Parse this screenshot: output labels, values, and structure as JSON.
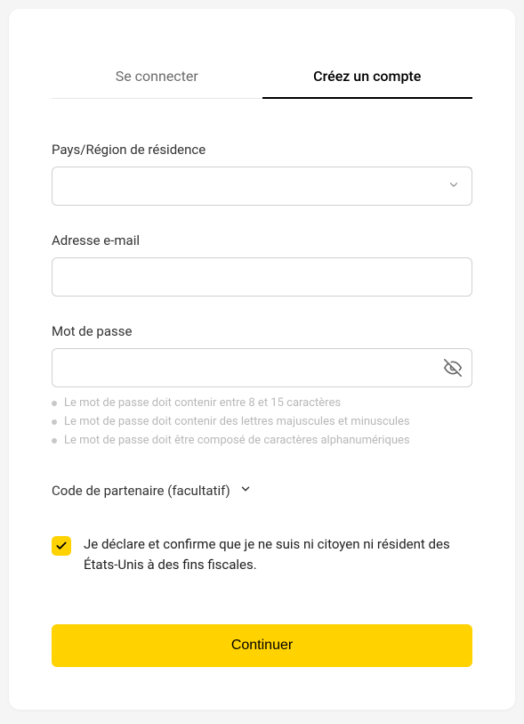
{
  "tabs": {
    "login": "Se connecter",
    "signup": "Créez un compte"
  },
  "fields": {
    "country": {
      "label": "Pays/Région de résidence"
    },
    "email": {
      "label": "Adresse e-mail"
    },
    "password": {
      "label": "Mot de passe",
      "hints": [
        "Le mot de passe doit contenir entre 8 et 15 caractères",
        "Le mot de passe doit contenir des lettres majuscules et minuscules",
        "Le mot de passe doit être composé de caractères alphanumériques"
      ]
    }
  },
  "partner": {
    "label": "Code de partenaire (facultatif)"
  },
  "declaration": {
    "text": "Je déclare et confirme que je ne suis ni citoyen ni résident des États-Unis à des fins fiscales.",
    "checked": true
  },
  "actions": {
    "continue": "Continuer"
  }
}
